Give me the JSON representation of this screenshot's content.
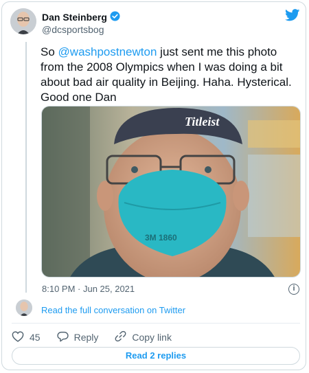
{
  "author": {
    "name": "Dan Steinberg",
    "handle": "@dcsportsbog",
    "verified": true
  },
  "tweet": {
    "text_before": "So ",
    "mention": "@washpostnewton",
    "text_after": " just sent me this photo from the 2008 Olympics when I was doing a bit about bad air quality in Beijing. Haha. Hysterical. Good one Dan",
    "timestamp": "8:10 PM · Jun 25, 2021",
    "photo_cap_text": "Titleist",
    "photo_mask_text": "3M 1860"
  },
  "conversation": {
    "link_label": "Read the full conversation on Twitter"
  },
  "actions": {
    "like_count": "45",
    "reply_label": "Reply",
    "copy_label": "Copy link"
  },
  "replies_button": {
    "label": "Read 2 replies"
  },
  "colors": {
    "accent": "#1d9bf0",
    "muted": "#536471",
    "border": "#cfd9de"
  },
  "icons": {
    "verified": "verified-badge-icon",
    "brand": "twitter-bird-icon",
    "info": "info-icon",
    "like": "heart-icon",
    "reply": "speech-bubble-icon",
    "copy": "link-icon"
  }
}
